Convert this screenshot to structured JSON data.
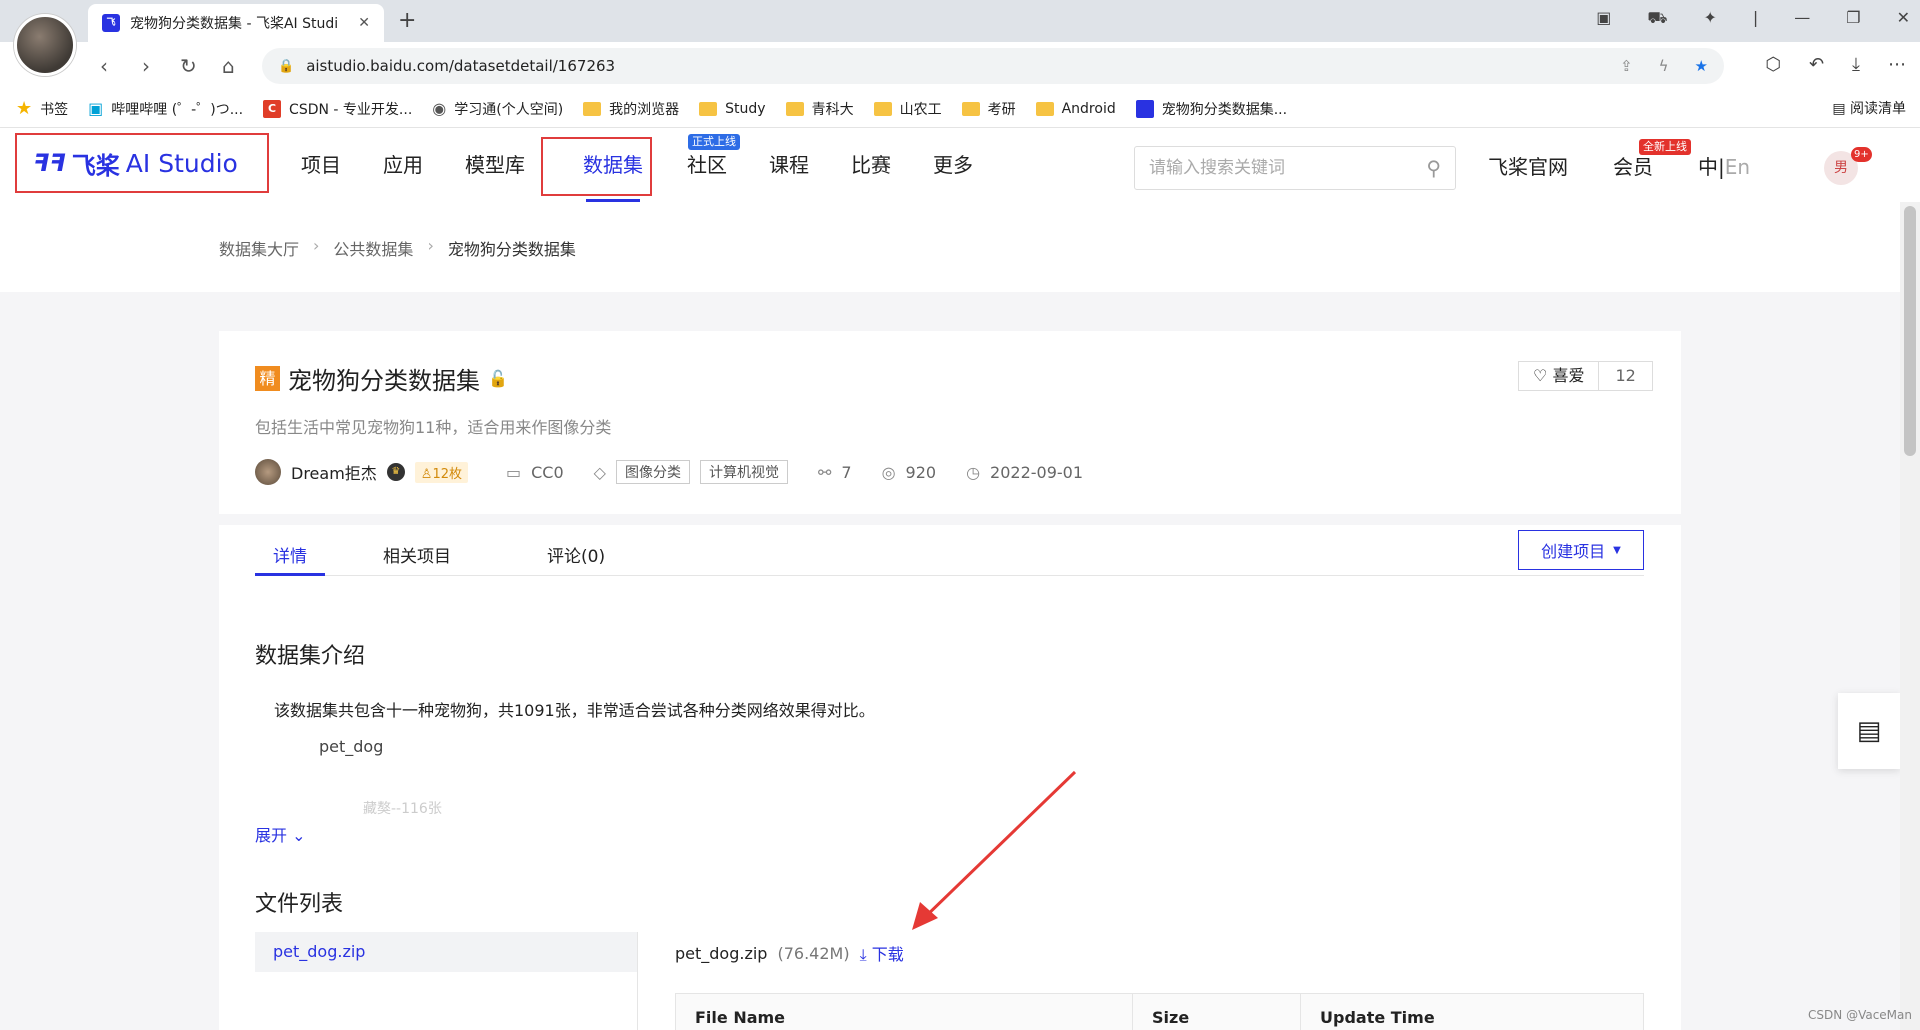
{
  "browser": {
    "tab_title": "宠物狗分类数据集 - 飞桨AI Studi",
    "url": "aistudio.baidu.com/datasetdetail/167263",
    "bookmarks": [
      "书签",
      "哔哩哔哩 (゜-゜)つ...",
      "CSDN - 专业开发...",
      "学习通(个人空间)",
      "我的浏览器",
      "Study",
      "青科大",
      "山农工",
      "考研",
      "Android",
      "宠物狗分类数据集..."
    ],
    "reading_list": "阅读清单"
  },
  "site": {
    "logo_mark": "ꟻꟻ",
    "logo_zh": "飞桨",
    "logo_text": "AI Studio",
    "nav": [
      "项目",
      "应用",
      "模型库",
      "数据集",
      "社区",
      "课程",
      "比赛",
      "更多"
    ],
    "community_badge": "正式上线",
    "search_placeholder": "请输入搜索关键词",
    "official": "飞桨官网",
    "member": "会员",
    "member_badge": "全新上线",
    "lang_zh": "中",
    "lang_en": "En",
    "user_avatar": "男",
    "user_badge": "9+"
  },
  "breadcrumb": [
    "数据集大厅",
    "公共数据集",
    "宠物狗分类数据集"
  ],
  "dataset": {
    "badge": "精",
    "title": "宠物狗分类数据集",
    "like_label": "喜爱",
    "like_count": "12",
    "description": "包括生活中常见宠物狗11种，适合用来作图像分类",
    "author": "Dream拒杰",
    "coins": "12枚",
    "license": "CC0",
    "tags": [
      "图像分类",
      "计算机视觉"
    ],
    "links": "7",
    "views": "920",
    "date": "2022-09-01"
  },
  "tabs": [
    "详情",
    "相关项目",
    "评论(0)"
  ],
  "create_button": "创建项目",
  "intro": {
    "heading": "数据集介绍",
    "text": "该数据集共包含十一种宠物狗，共1091张，非常适合尝试各种分类网络效果得对比。",
    "folder": "pet_dog",
    "faded": "藏獒--116张",
    "expand": "展开"
  },
  "files": {
    "heading": "文件列表",
    "list_item": "pet_dog.zip",
    "file_name": "pet_dog.zip",
    "file_size": "(76.42M)",
    "download": "下载",
    "columns": [
      "File Name",
      "Size",
      "Update Time"
    ]
  },
  "watermark": "CSDN @VaceMan"
}
